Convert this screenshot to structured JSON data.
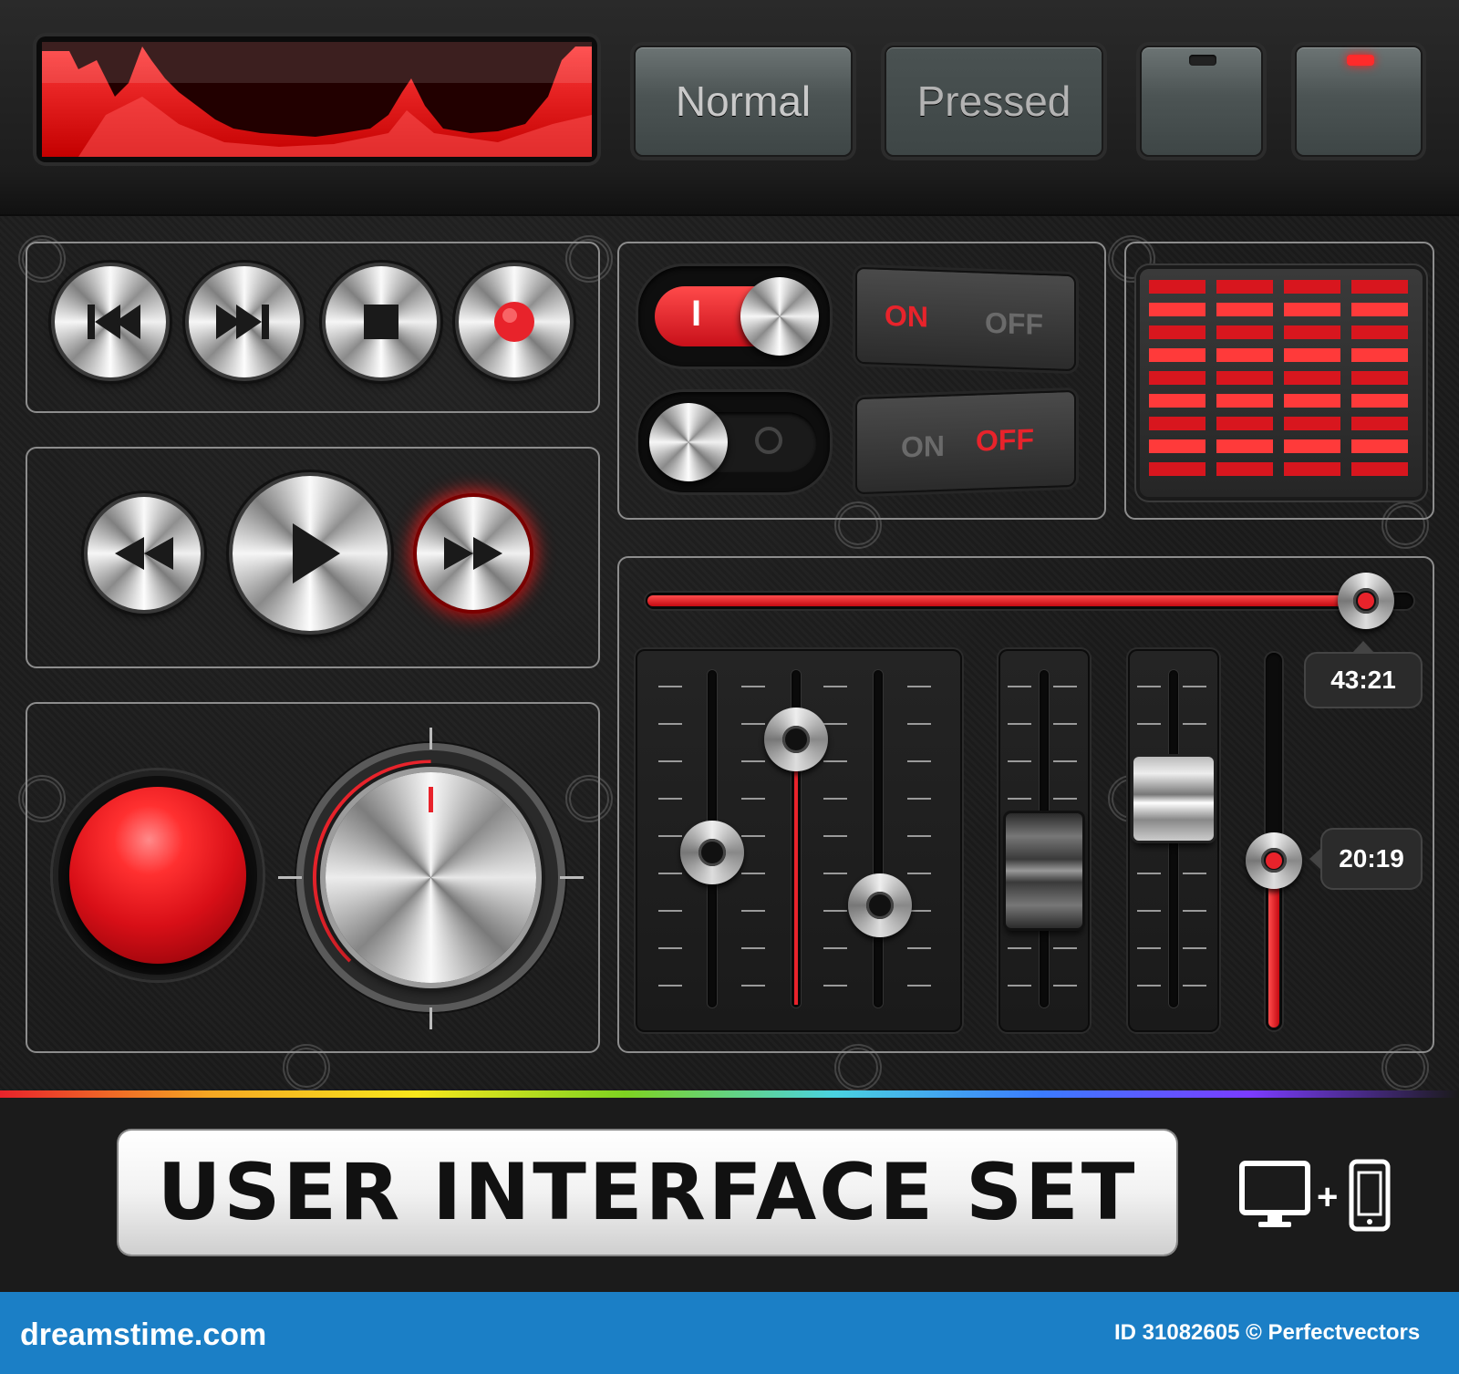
{
  "top_buttons": {
    "normal_label": "Normal",
    "pressed_label": "Pressed"
  },
  "switches": {
    "toggle_on_label": "I",
    "rocker_on_label": "ON",
    "rocker_off_label": "OFF"
  },
  "slider": {
    "progress": 0.96,
    "time_label": "43:21"
  },
  "vertical_slider": {
    "level": 0.45,
    "time_label": "20:19"
  },
  "banner": {
    "title": "USER INTERFACE SET"
  },
  "footer": {
    "site": "dreamstime.com",
    "credit": "ID 31082605 © Perfectvectors"
  },
  "colors": {
    "accent": "#e8232b",
    "panel_bg": "#1b1b1b",
    "footer_bg": "#1b7fc6"
  }
}
